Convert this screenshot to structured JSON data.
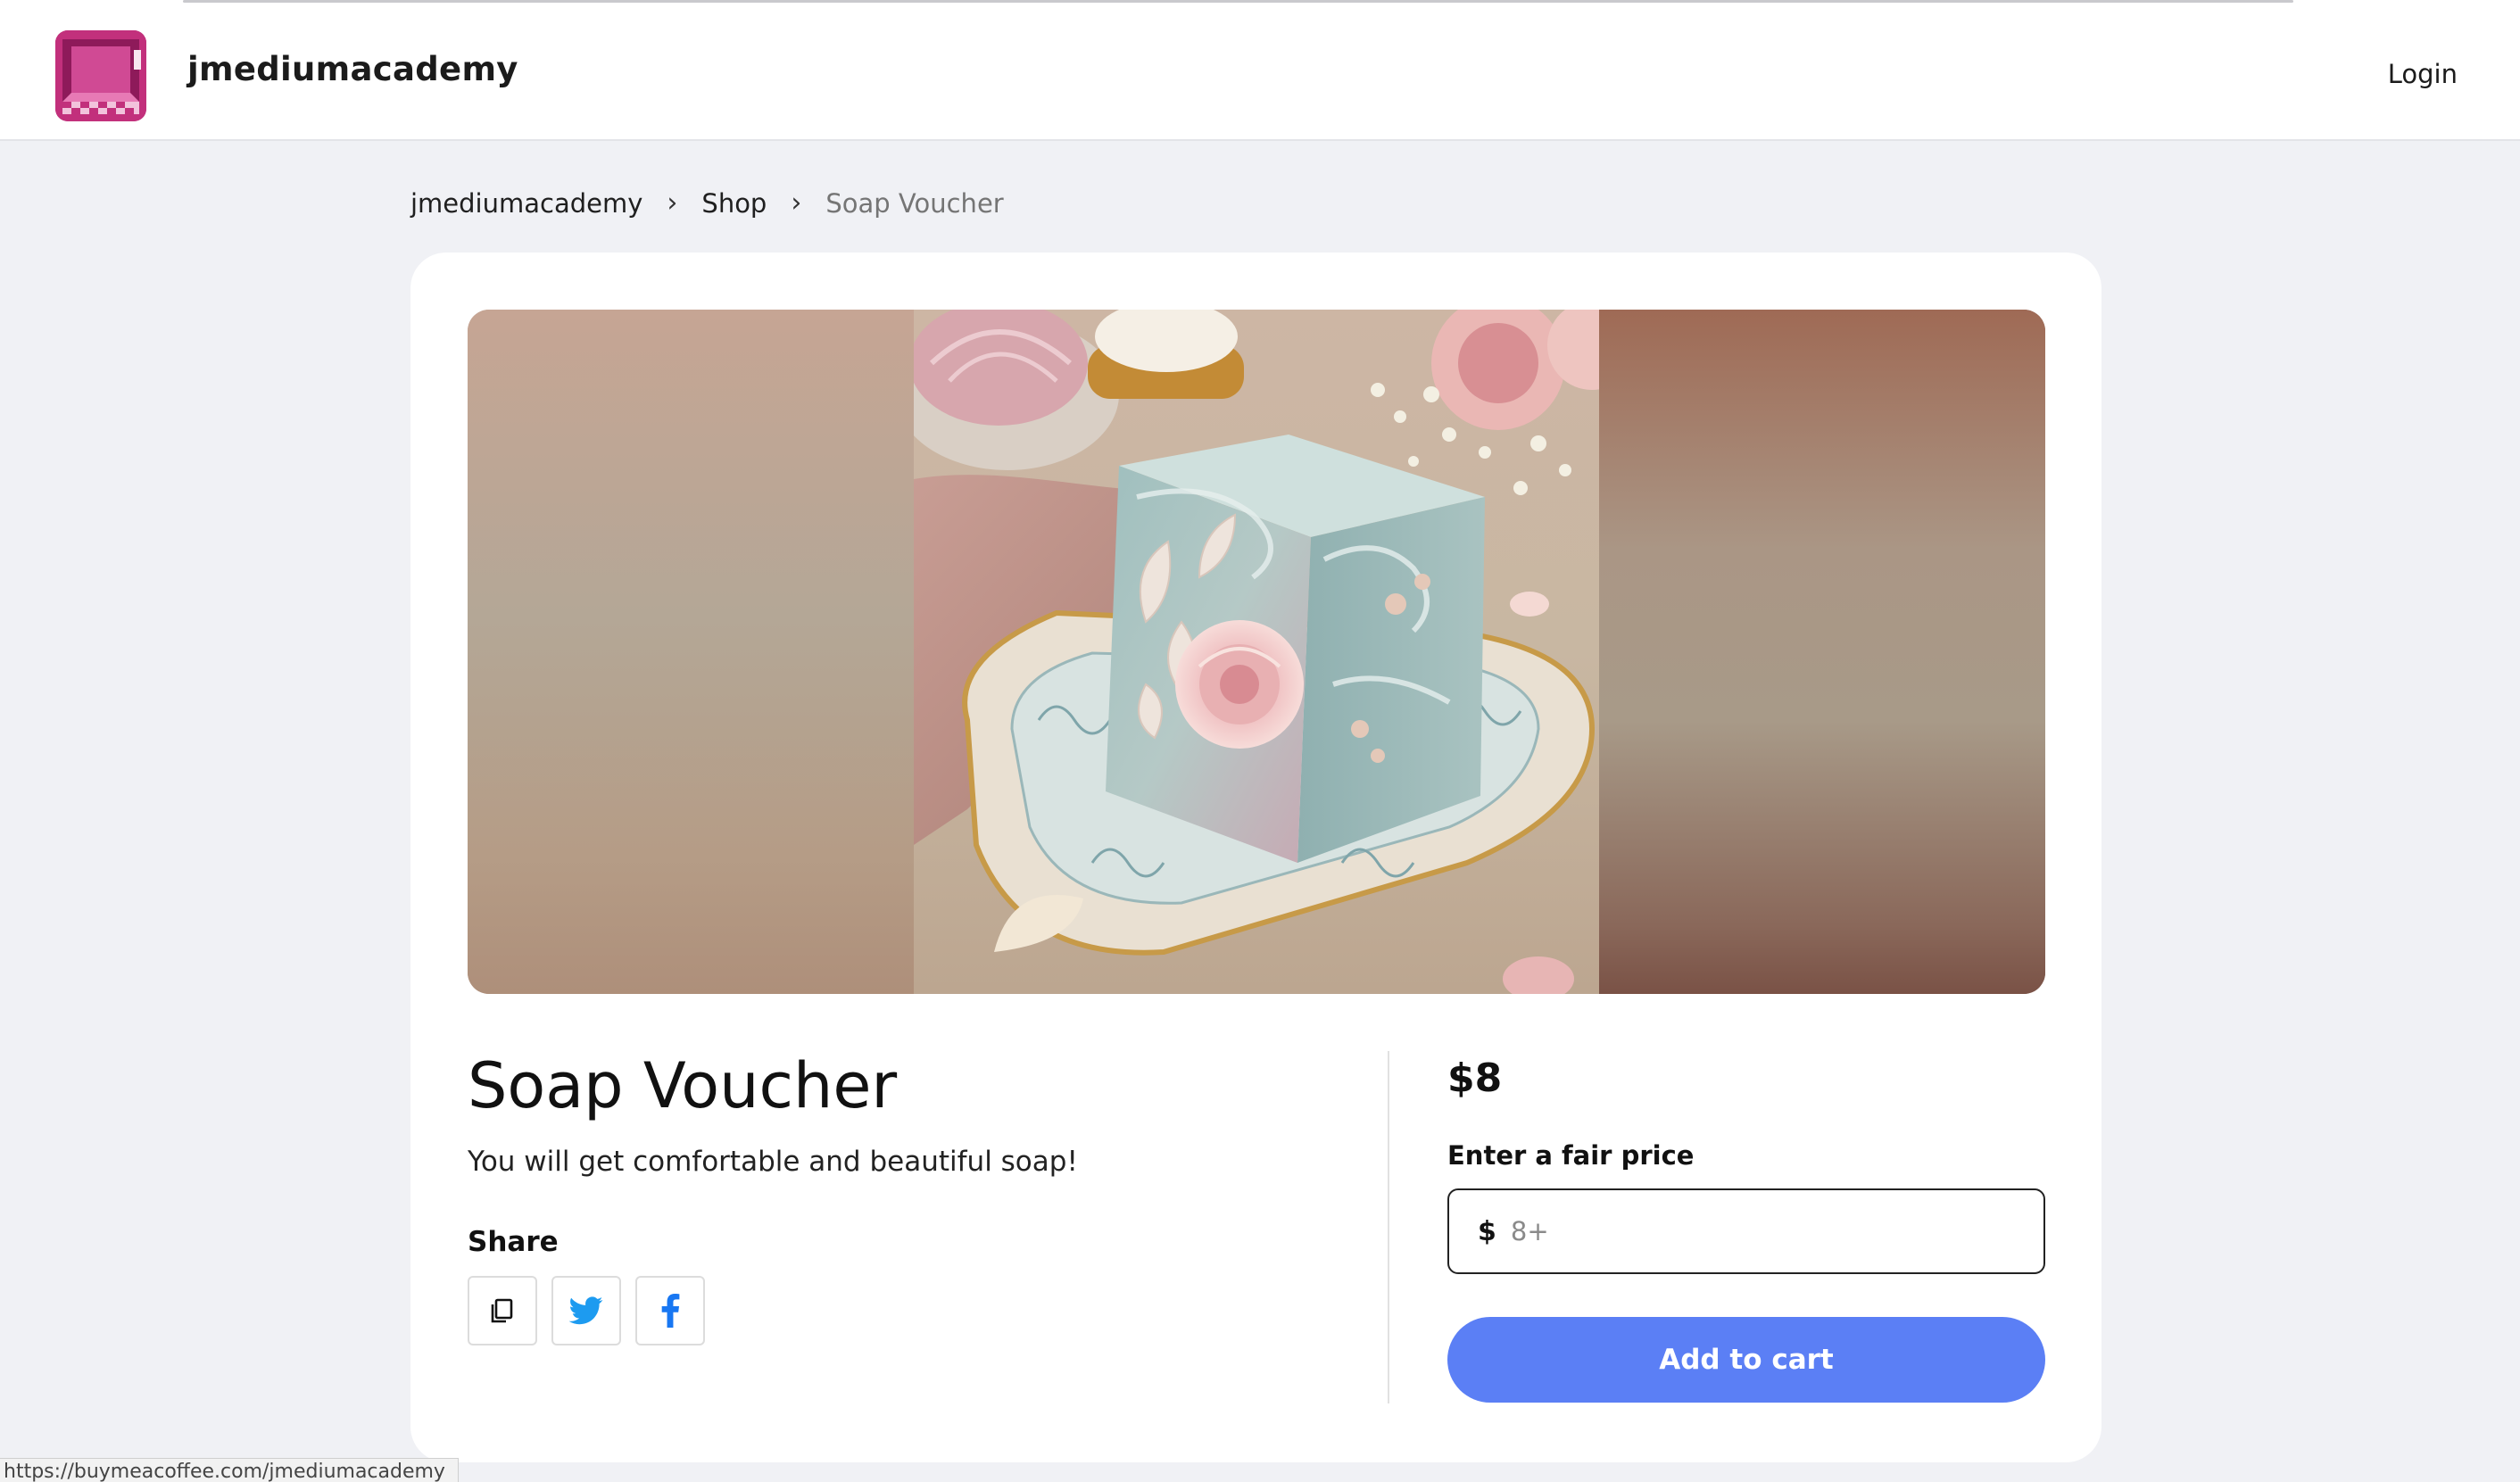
{
  "header": {
    "brand": "jmediumacademy",
    "login_label": "Login",
    "avatar_icon": "creator-avatar-icon"
  },
  "breadcrumb": {
    "items": [
      "jmediumacademy",
      "Shop",
      "Soap Voucher"
    ],
    "separator_icon": "chevron-right-icon"
  },
  "product": {
    "title": "Soap Voucher",
    "description": "You will get comfortable and beautiful soap!",
    "image_subject": "floral-soap-bar-image",
    "share": {
      "label": "Share",
      "buttons": [
        {
          "icon": "copy-link-icon"
        },
        {
          "icon": "twitter-icon",
          "color": "#1d9bf0"
        },
        {
          "icon": "facebook-icon",
          "color": "#1877f2"
        }
      ]
    }
  },
  "purchase": {
    "price": "$8",
    "fair_price_label": "Enter a fair price",
    "currency_symbol": "$",
    "input_placeholder": "8+",
    "input_value": "",
    "add_to_cart_label": "Add to cart",
    "accent_color": "#5b7ff5"
  },
  "status_bar": {
    "url": "https://buymeacoffee.com/jmediumacademy"
  }
}
